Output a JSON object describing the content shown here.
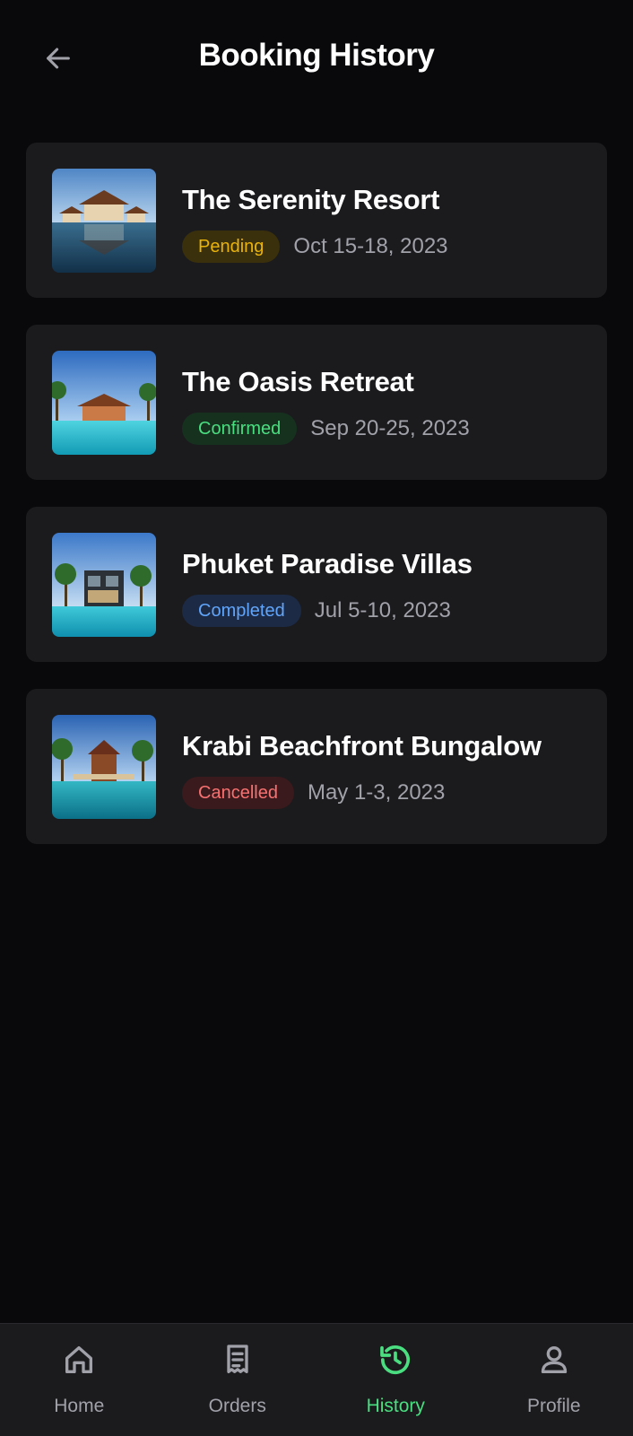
{
  "header": {
    "title": "Booking History",
    "back_icon": "arrow-left-icon"
  },
  "bookings": [
    {
      "name": "The Serenity Resort",
      "status": "Pending",
      "dates": "Oct 15-18, 2023",
      "status_color": "#eab308",
      "status_bg": "#3a300c"
    },
    {
      "name": "The Oasis Retreat",
      "status": "Confirmed",
      "dates": "Sep 20-25, 2023",
      "status_color": "#4ade80",
      "status_bg": "#16321f"
    },
    {
      "name": "Phuket Paradise Villas",
      "status": "Completed",
      "dates": "Jul 5-10, 2023",
      "status_color": "#60a5fa",
      "status_bg": "#1c2a45"
    },
    {
      "name": "Krabi Beachfront Bungalow",
      "status": "Cancelled",
      "dates": "May 1-3, 2023",
      "status_color": "#f87171",
      "status_bg": "#3a1a1c"
    }
  ],
  "tabbar": {
    "items": [
      {
        "label": "Home",
        "icon": "home-icon",
        "active": false
      },
      {
        "label": "Orders",
        "icon": "receipt-icon",
        "active": false
      },
      {
        "label": "History",
        "icon": "history-icon",
        "active": true
      },
      {
        "label": "Profile",
        "icon": "user-icon",
        "active": false
      }
    ],
    "active_color": "#4ade80",
    "inactive_color": "#a1a1aa"
  }
}
